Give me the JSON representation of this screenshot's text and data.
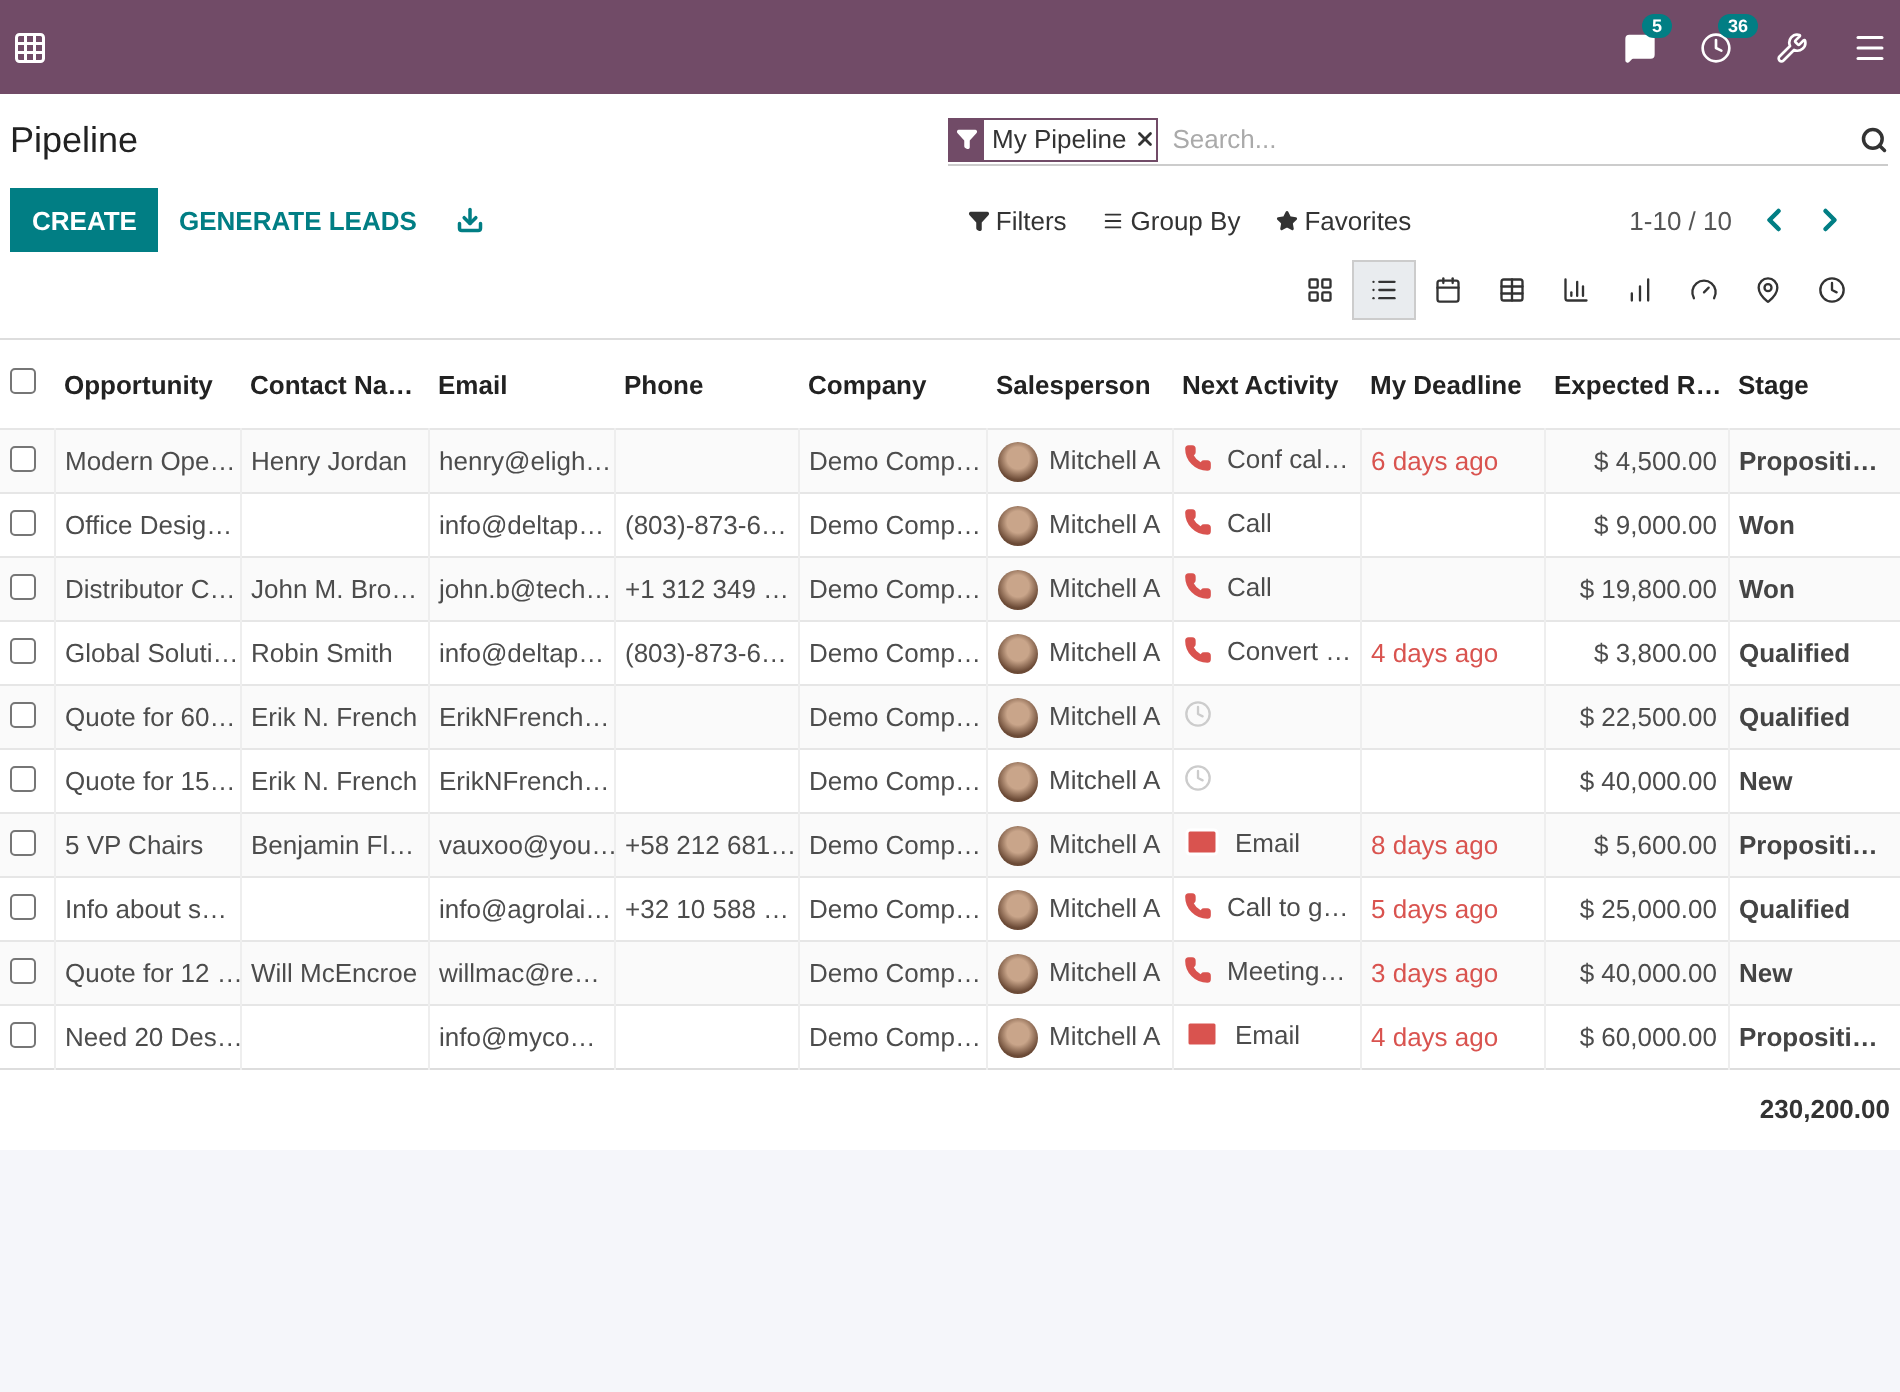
{
  "navbar": {
    "messages_badge": "5",
    "activities_badge": "36"
  },
  "title": "Pipeline",
  "search": {
    "facet": "My Pipeline",
    "placeholder": "Search..."
  },
  "buttons": {
    "create": "CREATE",
    "generate": "GENERATE LEADS"
  },
  "filters": [
    "Filters",
    "Group By",
    "Favorites"
  ],
  "pager": "1-10 / 10",
  "views": [
    {
      "kind": "kanban",
      "selected": false
    },
    {
      "kind": "list",
      "selected": true
    },
    {
      "kind": "calendar",
      "selected": false
    },
    {
      "kind": "pivot",
      "selected": false
    },
    {
      "kind": "graph",
      "selected": false
    },
    {
      "kind": "cohort",
      "selected": false
    },
    {
      "kind": "dashboard",
      "selected": false
    },
    {
      "kind": "map",
      "selected": false
    },
    {
      "kind": "activity",
      "selected": false
    }
  ],
  "table": {
    "select_all": false,
    "columns": [
      "Opportunity",
      "Contact Na…",
      "Email",
      "Phone",
      "Company",
      "Salesperson",
      "Next Activity",
      "My Deadline",
      "Expected R…",
      "Stage"
    ],
    "rows": [
      {
        "checked": false,
        "cells": [
          "Modern Ope…",
          "Henry Jordan",
          "henry@eligh…",
          "",
          "Demo Comp…",
          "Mitchell A"
        ],
        "activity": {
          "kind": "phone",
          "label": "Conf cal…"
        },
        "deadline": "6 days ago",
        "expected": "$ 4,500.00",
        "stage": "Propositi…"
      },
      {
        "checked": false,
        "cells": [
          "Office Desig…",
          "",
          "info@deltap…",
          "(803)-873-6…",
          "Demo Comp…",
          "Mitchell A"
        ],
        "activity": {
          "kind": "phone",
          "label": "Call"
        },
        "deadline": "",
        "expected": "$ 9,000.00",
        "stage": "Won"
      },
      {
        "checked": false,
        "cells": [
          "Distributor C…",
          "John M. Bro…",
          "john.b@tech…",
          "+1 312 349 …",
          "Demo Comp…",
          "Mitchell A"
        ],
        "activity": {
          "kind": "phone",
          "label": "Call"
        },
        "deadline": "",
        "expected": "$ 19,800.00",
        "stage": "Won"
      },
      {
        "checked": false,
        "cells": [
          "Global Soluti…",
          "Robin Smith",
          "info@deltap…",
          "(803)-873-6…",
          "Demo Comp…",
          "Mitchell A"
        ],
        "activity": {
          "kind": "phone",
          "label": "Convert …"
        },
        "deadline": "4 days ago",
        "expected": "$ 3,800.00",
        "stage": "Qualified"
      },
      {
        "checked": false,
        "cells": [
          "Quote for 60…",
          "Erik N. French",
          "ErikNFrench…",
          "",
          "Demo Comp…",
          "Mitchell A"
        ],
        "activity": {
          "kind": "none"
        },
        "deadline": "",
        "expected": "$ 22,500.00",
        "stage": "Qualified"
      },
      {
        "checked": false,
        "cells": [
          "Quote for 15…",
          "Erik N. French",
          "ErikNFrench…",
          "",
          "Demo Comp…",
          "Mitchell A"
        ],
        "activity": {
          "kind": "none"
        },
        "deadline": "",
        "expected": "$ 40,000.00",
        "stage": "New"
      },
      {
        "checked": false,
        "cells": [
          "5 VP Chairs",
          "Benjamin Fl…",
          "vauxoo@you…",
          "+58 212 681…",
          "Demo Comp…",
          "Mitchell A"
        ],
        "activity": {
          "kind": "email",
          "label": "Email"
        },
        "deadline": "8 days ago",
        "expected": "$ 5,600.00",
        "stage": "Propositi…"
      },
      {
        "checked": false,
        "cells": [
          "Info about s…",
          "",
          "info@agrolai…",
          "+32 10 588 …",
          "Demo Comp…",
          "Mitchell A"
        ],
        "activity": {
          "kind": "phone",
          "label": "Call to g…"
        },
        "deadline": "5 days ago",
        "expected": "$ 25,000.00",
        "stage": "Qualified"
      },
      {
        "checked": false,
        "cells": [
          "Quote for 12 …",
          "Will McEncroe",
          "willmac@re…",
          "",
          "Demo Comp…",
          "Mitchell A"
        ],
        "activity": {
          "kind": "phone",
          "label": "Meeting…"
        },
        "deadline": "3 days ago",
        "expected": "$ 40,000.00",
        "stage": "New"
      },
      {
        "checked": false,
        "cells": [
          "Need 20 Des…",
          "",
          "info@myco…",
          "",
          "Demo Comp…",
          "Mitchell A"
        ],
        "activity": {
          "kind": "email",
          "label": "Email"
        },
        "deadline": "4 days ago",
        "expected": "$ 60,000.00",
        "stage": "Propositi…"
      }
    ],
    "total": "230,200.00"
  }
}
